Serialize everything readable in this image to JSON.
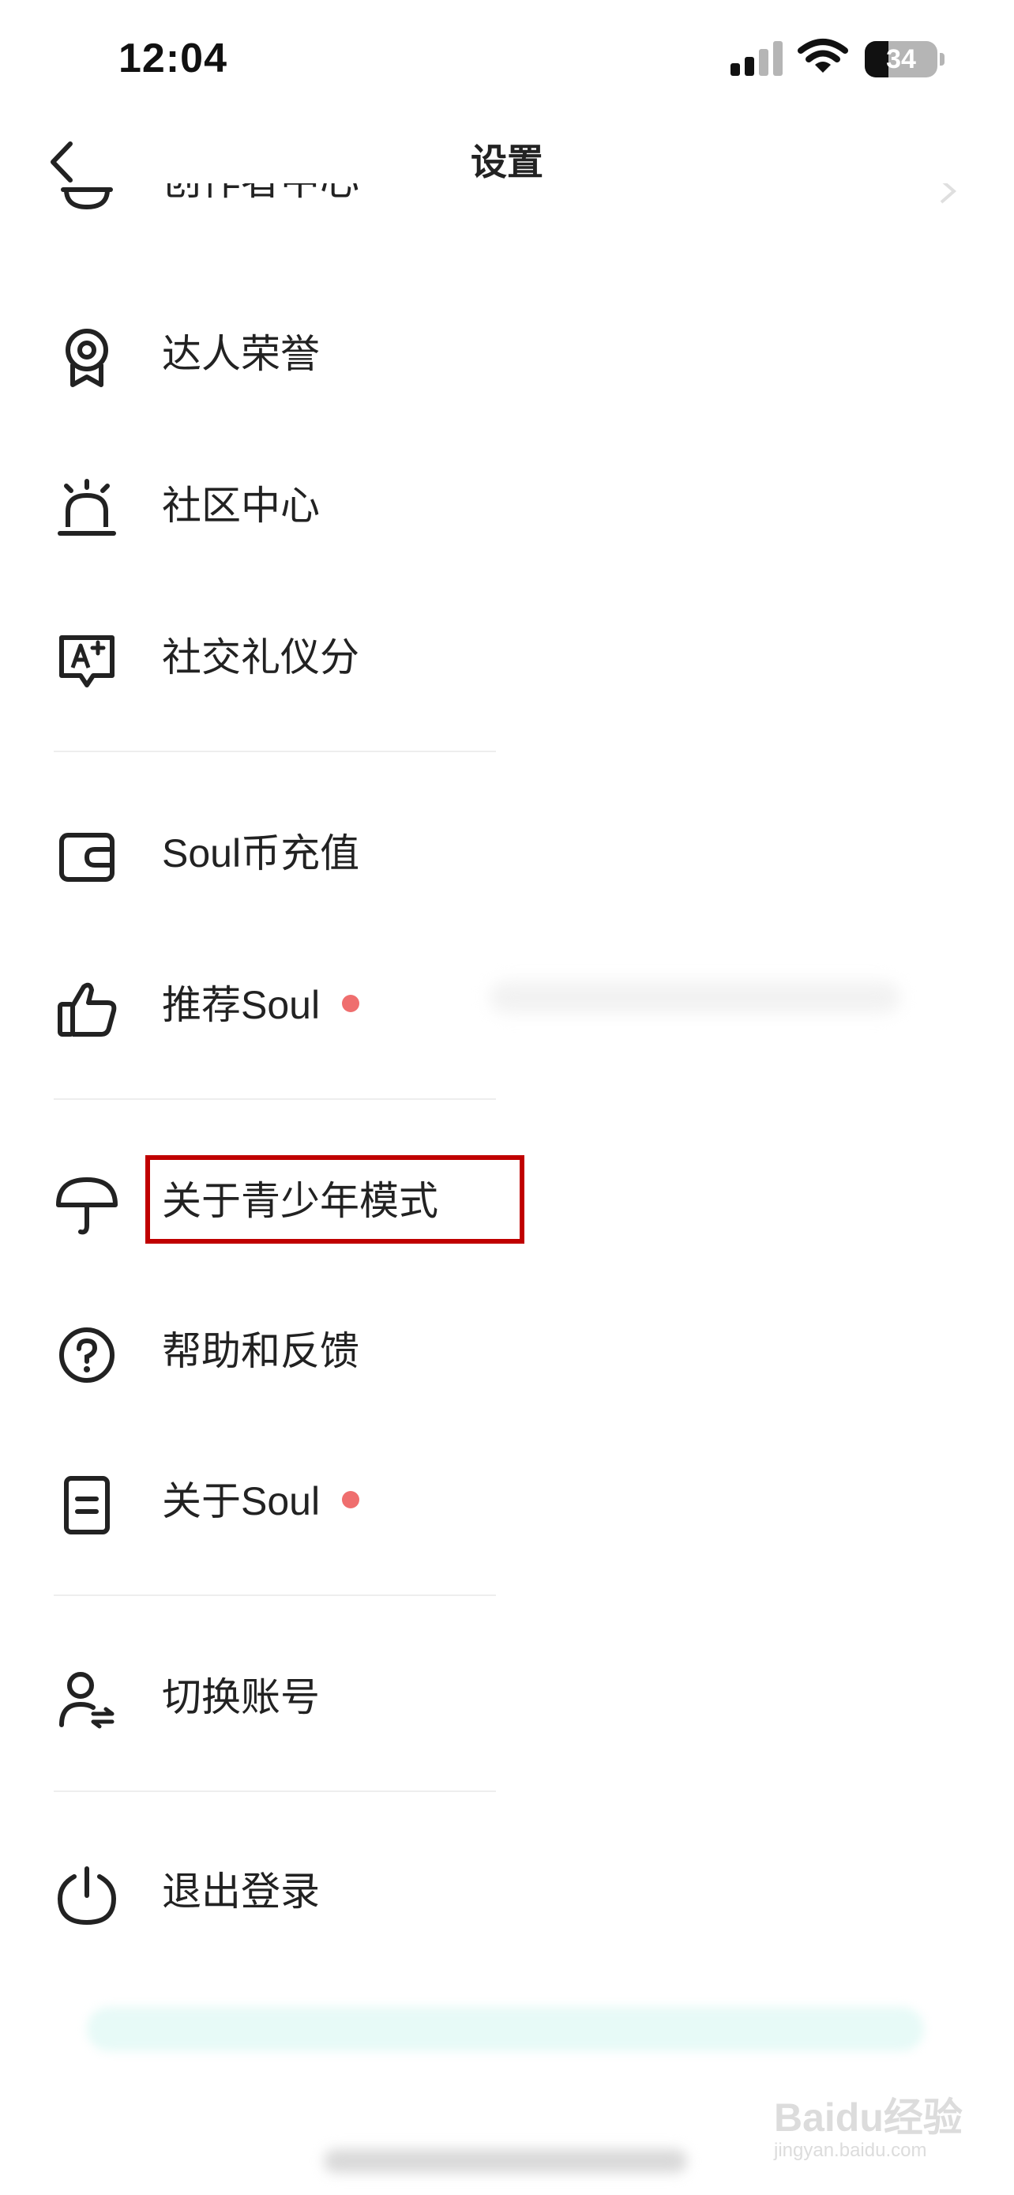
{
  "status_bar": {
    "time": "12:04",
    "battery": "34"
  },
  "nav": {
    "title": "设置"
  },
  "partial_item": {
    "label": "创作者中心"
  },
  "items": [
    {
      "label": "达人荣誉",
      "icon": "medal-icon"
    },
    {
      "label": "社区中心",
      "icon": "alarm-light-icon"
    },
    {
      "label": "社交礼仪分",
      "icon": "score-badge-icon"
    },
    {
      "label": "Soul币充值",
      "icon": "wallet-icon"
    },
    {
      "label": "推荐Soul",
      "icon": "thumbs-up-icon",
      "badge_dot": true
    },
    {
      "label": "关于青少年模式",
      "icon": "umbrella-icon"
    },
    {
      "label": "帮助和反馈",
      "icon": "question-circle-icon"
    },
    {
      "label": "关于Soul",
      "icon": "document-icon",
      "badge_dot": true
    },
    {
      "label": "切换账号",
      "icon": "switch-account-icon"
    },
    {
      "label": "退出登录",
      "icon": "power-icon"
    }
  ],
  "watermark": {
    "text": "Baidu经验",
    "sub": "jingyan.baidu.com"
  },
  "colors": {
    "badge_dot": "#ef6e6e",
    "highlight_border": "#c00000"
  }
}
